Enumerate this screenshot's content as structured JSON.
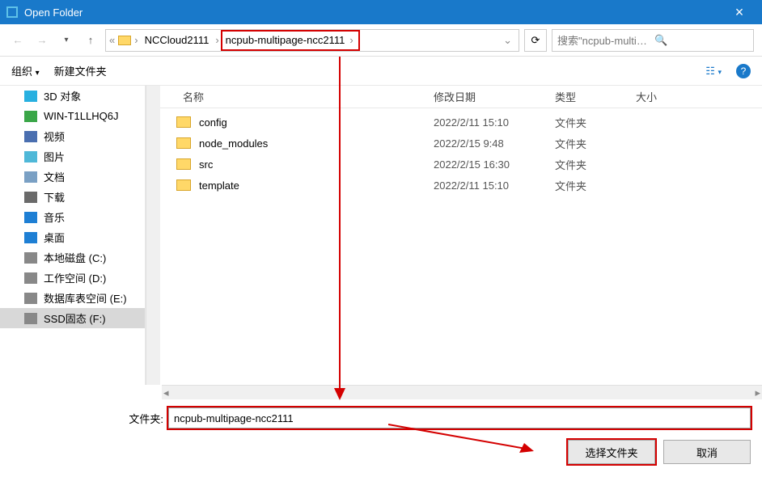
{
  "title": "Open Folder",
  "breadcrumb": {
    "prefix_items": [
      "NCCloud2111"
    ],
    "current": "ncpub-multipage-ncc2111"
  },
  "search": {
    "placeholder": "搜索\"ncpub-multipage-ncc..."
  },
  "toolbar": {
    "organize": "组织",
    "newfolder": "新建文件夹"
  },
  "sidebar": [
    {
      "label": "3D 对象",
      "color": "#28b0e0"
    },
    {
      "label": "WIN-T1LLHQ6J",
      "color": "#3aa648"
    },
    {
      "label": "视频",
      "color": "#4a6fb0"
    },
    {
      "label": "图片",
      "color": "#4fb8d8"
    },
    {
      "label": "文档",
      "color": "#7aa0c4"
    },
    {
      "label": "下载",
      "color": "#6a6a6a"
    },
    {
      "label": "音乐",
      "color": "#1e7fd4"
    },
    {
      "label": "桌面",
      "color": "#1e7fd4"
    },
    {
      "label": "本地磁盘 (C:)",
      "color": "#888"
    },
    {
      "label": "工作空间 (D:)",
      "color": "#888"
    },
    {
      "label": "数据库表空间 (E:)",
      "color": "#888"
    },
    {
      "label": "SSD固态 (F:)",
      "color": "#888",
      "sel": true
    }
  ],
  "columns": {
    "name": "名称",
    "date": "修改日期",
    "type": "类型",
    "size": "大小"
  },
  "rows": [
    {
      "name": "config",
      "date": "2022/2/11 15:10",
      "type": "文件夹"
    },
    {
      "name": "node_modules",
      "date": "2022/2/15 9:48",
      "type": "文件夹"
    },
    {
      "name": "src",
      "date": "2022/2/15 16:30",
      "type": "文件夹"
    },
    {
      "name": "template",
      "date": "2022/2/11 15:10",
      "type": "文件夹"
    }
  ],
  "foldername": {
    "label": "文件夹:",
    "value": "ncpub-multipage-ncc2111"
  },
  "buttons": {
    "select": "选择文件夹",
    "cancel": "取消"
  }
}
